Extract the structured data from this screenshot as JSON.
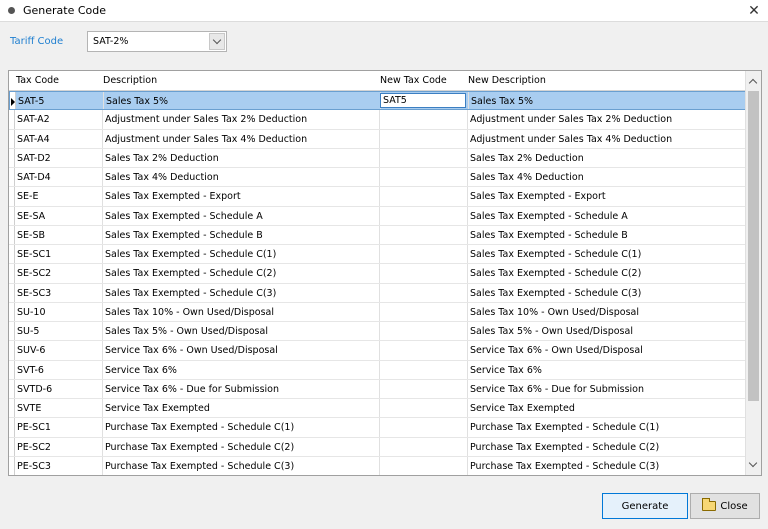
{
  "window": {
    "title": "Generate Code"
  },
  "tariff": {
    "label": "Tariff Code",
    "value": "SAT-2%"
  },
  "grid": {
    "columns": [
      "Tax Code",
      "Description",
      "New Tax Code",
      "New Description"
    ],
    "editing_value": "SAT5",
    "rows": [
      {
        "code": "SAT-5",
        "desc": "Sales Tax 5%",
        "new_code": "",
        "new_desc": "Sales Tax 5%"
      },
      {
        "code": "SAT-A2",
        "desc": "Adjustment under Sales Tax 2% Deduction",
        "new_code": "",
        "new_desc": "Adjustment under Sales Tax 2% Deduction"
      },
      {
        "code": "SAT-A4",
        "desc": "Adjustment under Sales Tax 4% Deduction",
        "new_code": "",
        "new_desc": "Adjustment under Sales Tax 4% Deduction"
      },
      {
        "code": "SAT-D2",
        "desc": "Sales Tax 2% Deduction",
        "new_code": "",
        "new_desc": "Sales Tax 2% Deduction"
      },
      {
        "code": "SAT-D4",
        "desc": "Sales Tax 4% Deduction",
        "new_code": "",
        "new_desc": "Sales Tax 4% Deduction"
      },
      {
        "code": "SE-E",
        "desc": "Sales Tax Exempted - Export",
        "new_code": "",
        "new_desc": "Sales Tax Exempted - Export"
      },
      {
        "code": "SE-SA",
        "desc": "Sales Tax Exempted - Schedule A",
        "new_code": "",
        "new_desc": "Sales Tax Exempted - Schedule A"
      },
      {
        "code": "SE-SB",
        "desc": "Sales Tax Exempted - Schedule B",
        "new_code": "",
        "new_desc": "Sales Tax Exempted - Schedule B"
      },
      {
        "code": "SE-SC1",
        "desc": "Sales Tax Exempted - Schedule C(1)",
        "new_code": "",
        "new_desc": "Sales Tax Exempted - Schedule C(1)"
      },
      {
        "code": "SE-SC2",
        "desc": "Sales Tax Exempted - Schedule C(2)",
        "new_code": "",
        "new_desc": "Sales Tax Exempted - Schedule C(2)"
      },
      {
        "code": "SE-SC3",
        "desc": "Sales Tax Exempted - Schedule C(3)",
        "new_code": "",
        "new_desc": "Sales Tax Exempted - Schedule C(3)"
      },
      {
        "code": "SU-10",
        "desc": "Sales Tax 10% - Own Used/Disposal",
        "new_code": "",
        "new_desc": "Sales Tax 10% - Own Used/Disposal"
      },
      {
        "code": "SU-5",
        "desc": "Sales Tax 5% - Own Used/Disposal",
        "new_code": "",
        "new_desc": "Sales Tax 5% - Own Used/Disposal"
      },
      {
        "code": "SUV-6",
        "desc": "Service Tax 6% - Own Used/Disposal",
        "new_code": "",
        "new_desc": "Service Tax 6% - Own Used/Disposal"
      },
      {
        "code": "SVT-6",
        "desc": "Service Tax 6%",
        "new_code": "",
        "new_desc": "Service Tax 6%"
      },
      {
        "code": "SVTD-6",
        "desc": "Service Tax 6% - Due for Submission",
        "new_code": "",
        "new_desc": "Service Tax 6% - Due for Submission"
      },
      {
        "code": "SVTE",
        "desc": "Service Tax Exempted",
        "new_code": "",
        "new_desc": "Service Tax Exempted"
      },
      {
        "code": "PE-SC1",
        "desc": "Purchase Tax Exempted - Schedule C(1)",
        "new_code": "",
        "new_desc": "Purchase Tax Exempted - Schedule C(1)"
      },
      {
        "code": "PE-SC2",
        "desc": "Purchase Tax Exempted - Schedule C(2)",
        "new_code": "",
        "new_desc": "Purchase Tax Exempted - Schedule C(2)"
      },
      {
        "code": "PE-SC3",
        "desc": "Purchase Tax Exempted - Schedule C(3)",
        "new_code": "",
        "new_desc": "Purchase Tax Exempted - Schedule C(3)"
      }
    ]
  },
  "buttons": {
    "generate": "Generate",
    "close": "Close"
  },
  "icons": {
    "close_window": "close-icon",
    "combo": "chevron-down-icon",
    "close_button": "folder-icon"
  },
  "colors": {
    "accent": "#1f7fd0",
    "selected_row": "#a9cdf0"
  }
}
